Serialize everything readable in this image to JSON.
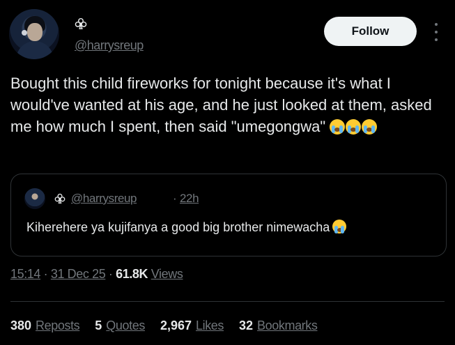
{
  "author": {
    "avatar_icon": "profile-avatar",
    "badge_icon": "club-icon",
    "handle": "@harrysreup"
  },
  "follow_label": "Follow",
  "tweet": {
    "text": "Bought this child fireworks for tonight because it's what I would've wanted at his age, and he just looked at them, asked me how much I spent, then said \"umegongwa\"",
    "emoji_icon": "loudly-crying-face-emoji",
    "emoji_count": 3
  },
  "quote": {
    "handle": "@harrysreup",
    "separator": "·",
    "time": "22h",
    "text": "Kiherehere ya kujifanya a good big brother nimewacha"
  },
  "meta": {
    "time": "15:14",
    "sep1": " · ",
    "date": "31 Dec 25",
    "sep2": " · ",
    "views_count": "61.8K",
    "views_label": "Views"
  },
  "stats": [
    {
      "num": "380",
      "label": "Reposts"
    },
    {
      "num": "5",
      "label": "Quotes"
    },
    {
      "num": "2,967",
      "label": "Likes"
    },
    {
      "num": "32",
      "label": "Bookmarks"
    }
  ],
  "colors": {
    "background": "#000000",
    "text": "#e7e9ea",
    "muted": "#71767b",
    "border": "#2f3336",
    "button_bg": "#eff3f4"
  }
}
